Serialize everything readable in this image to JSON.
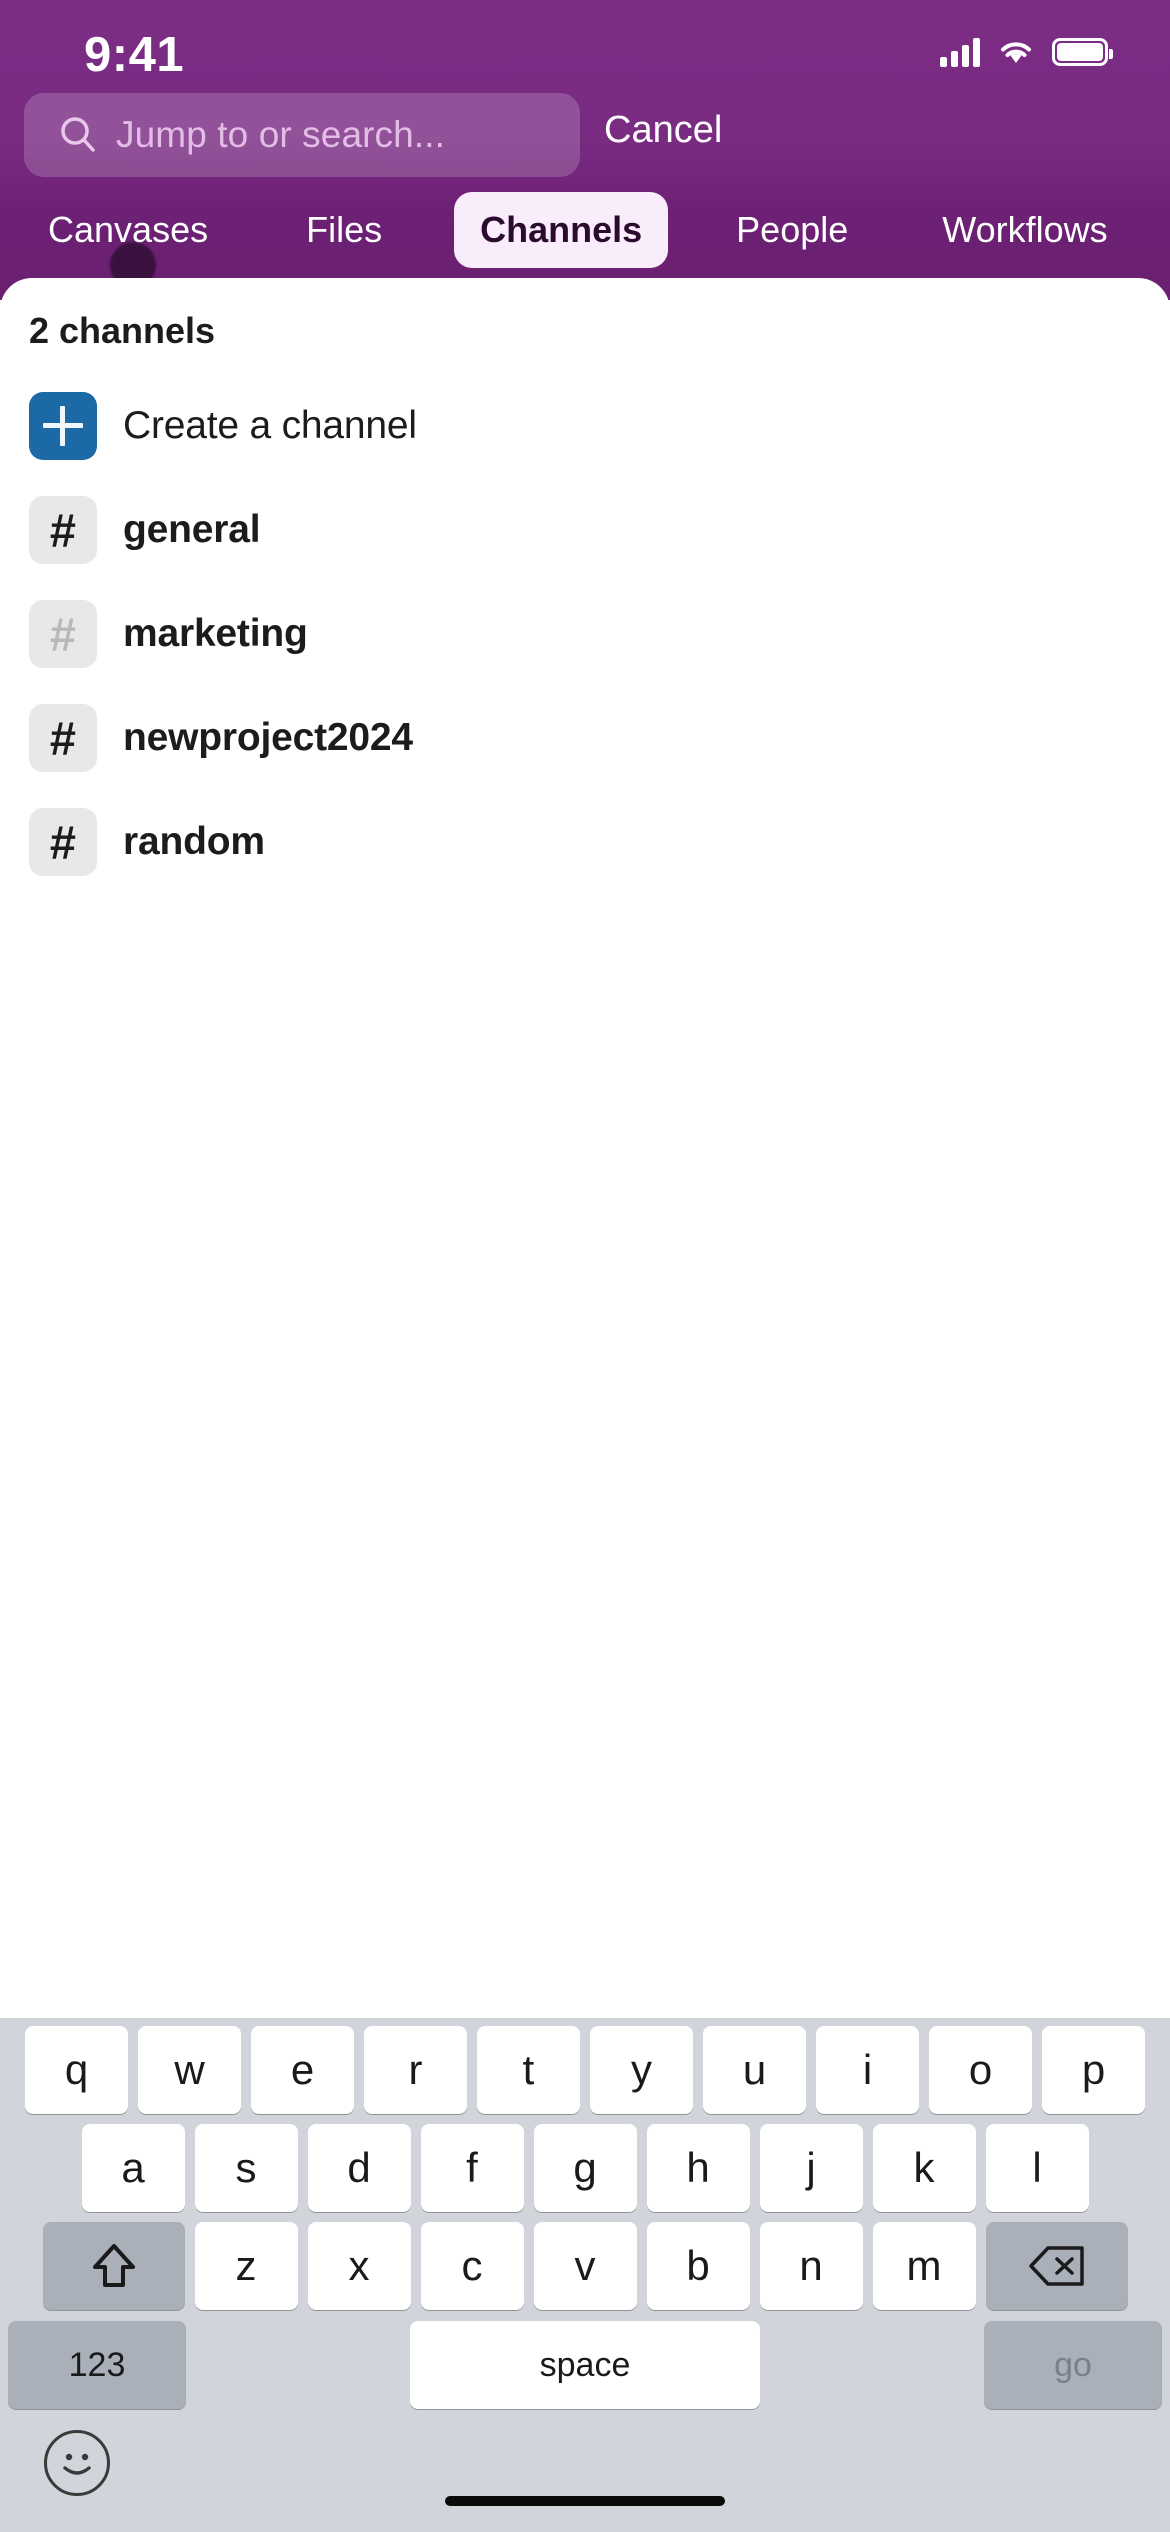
{
  "statusbar": {
    "time": "9:41",
    "signal_icon": "cellular-signal-icon",
    "wifi_icon": "wifi-icon",
    "battery_icon": "battery-icon"
  },
  "search": {
    "icon": "search-icon",
    "placeholder": "Jump to or search...",
    "value": "",
    "cancel_label": "Cancel"
  },
  "tabs": [
    {
      "label": "Canvases",
      "selected": false
    },
    {
      "label": "Files",
      "selected": false
    },
    {
      "label": "Channels",
      "selected": true
    },
    {
      "label": "People",
      "selected": false
    },
    {
      "label": "Workflows",
      "selected": false
    }
  ],
  "results": {
    "count_label": "2 channels",
    "rows": [
      {
        "label": "Create a channel",
        "icon": "plus-icon",
        "icon_style": "create"
      },
      {
        "label": "general",
        "icon": "hash-icon",
        "icon_style": "hash"
      },
      {
        "label": "marketing",
        "icon": "hash-icon",
        "icon_style": "hash-muted"
      },
      {
        "label": "newproject2024",
        "icon": "hash-icon",
        "icon_style": "hash"
      },
      {
        "label": "random",
        "icon": "hash-icon",
        "icon_style": "hash"
      }
    ]
  },
  "keyboard": {
    "row1": [
      "q",
      "w",
      "e",
      "r",
      "t",
      "y",
      "u",
      "i",
      "o",
      "p"
    ],
    "row2": [
      "a",
      "s",
      "d",
      "f",
      "g",
      "h",
      "j",
      "k",
      "l"
    ],
    "row3": [
      "z",
      "x",
      "c",
      "v",
      "b",
      "n",
      "m"
    ],
    "shift_label": "shift-key",
    "backspace_label": "backspace-key",
    "numbers_label": "123",
    "space_label": "space",
    "go_label": "go",
    "emoji_label": "emoji-key"
  },
  "colors": {
    "header_purple": "#6d2174",
    "chip_selected_bg": "#f9edfb",
    "create_icon_blue": "#1b6aa5",
    "hash_icon_bg": "#e8e8e8",
    "keyboard_bg": "#d1d4da"
  }
}
